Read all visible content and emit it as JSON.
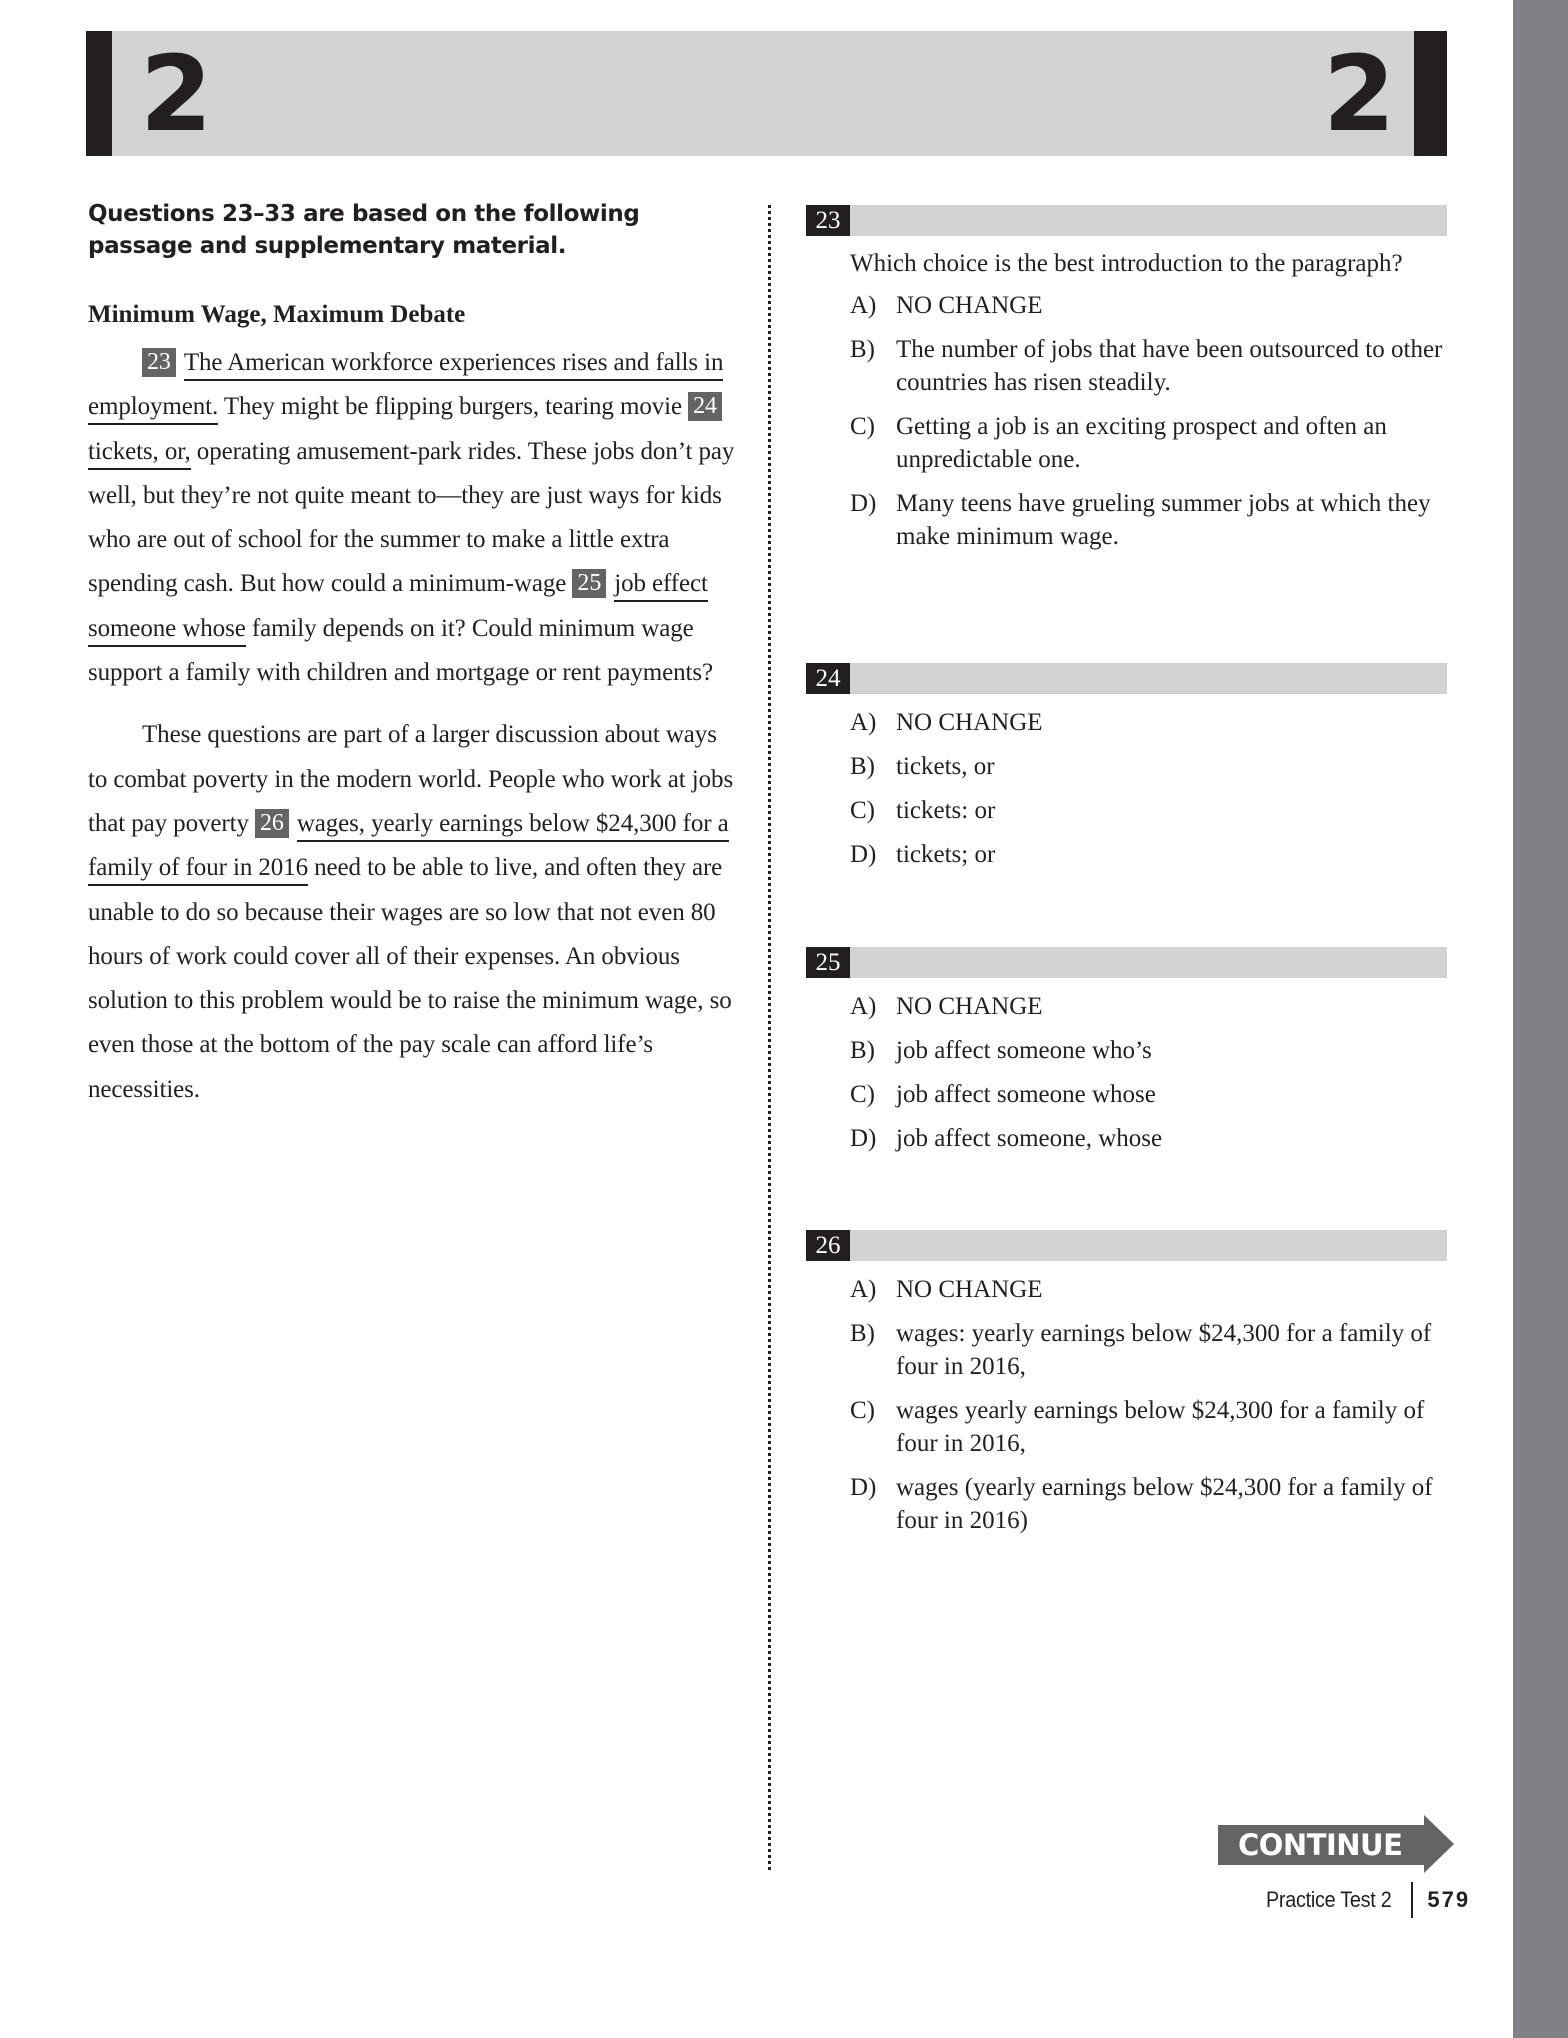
{
  "header": {
    "section_number_left": "2",
    "section_number_right": "2"
  },
  "passage": {
    "intro": "Questions 23–33 are based on the following passage and supplementary material.",
    "title": "Minimum Wage, Maximum Debate",
    "paragraph1": {
      "q23_num": "23",
      "q23_underlined": "The American workforce experiences rises and falls in employment.",
      "seg1": " They might be flipping burgers, tearing movie ",
      "q24_num": "24",
      "q24_underlined": "tickets, or,",
      "seg2": " operating amusement-park rides. These jobs don’t pay well, but they’re not quite meant to—they are just ways for kids who are out of school for the summer to make a little extra spending cash. But how could a minimum-wage ",
      "q25_num": "25",
      "q25_underlined": "job effect someone whose",
      "seg3": " family depends on it? Could minimum wage support a family with children and mortgage or rent payments?"
    },
    "paragraph2": {
      "seg1": "These questions are part of a larger discussion about ways to combat poverty in the modern world. People who work at jobs that pay poverty ",
      "q26_num": "26",
      "q26_underlined": "wages, yearly earnings below $24,300 for a family of four in 2016",
      "seg2": " need to be able to live, and often they are unable to do so because their wages are so low that not even 80 hours of work could cover all of their expenses. An obvious solution to this problem would be to raise the minimum wage, so even those at the bottom of the pay scale can afford life’s necessities."
    }
  },
  "questions": [
    {
      "number": "23",
      "stem": "Which choice is the best introduction to the paragraph?",
      "choices": [
        {
          "letter": "A)",
          "text": "NO CHANGE"
        },
        {
          "letter": "B)",
          "text": "The number of jobs that have been outsourced to other countries has risen steadily."
        },
        {
          "letter": "C)",
          "text": "Getting a job is an exciting prospect and often an unpredictable one."
        },
        {
          "letter": "D)",
          "text": "Many teens have grueling summer jobs at which they make minimum wage."
        }
      ]
    },
    {
      "number": "24",
      "choices": [
        {
          "letter": "A)",
          "text": "NO CHANGE"
        },
        {
          "letter": "B)",
          "text": "tickets, or"
        },
        {
          "letter": "C)",
          "text": "tickets: or"
        },
        {
          "letter": "D)",
          "text": "tickets; or"
        }
      ]
    },
    {
      "number": "25",
      "choices": [
        {
          "letter": "A)",
          "text": "NO CHANGE"
        },
        {
          "letter": "B)",
          "text": "job affect someone who’s"
        },
        {
          "letter": "C)",
          "text": "job affect someone whose"
        },
        {
          "letter": "D)",
          "text": "job affect someone, whose"
        }
      ]
    },
    {
      "number": "26",
      "choices": [
        {
          "letter": "A)",
          "text": "NO CHANGE"
        },
        {
          "letter": "B)",
          "text": "wages: yearly earnings below $24,300 for a family of four in 2016,"
        },
        {
          "letter": "C)",
          "text": "wages yearly earnings below $24,300 for a family of four in 2016,"
        },
        {
          "letter": "D)",
          "text": "wages (yearly earnings below $24,300 for a family of four in 2016)"
        }
      ]
    }
  ],
  "footer": {
    "continue_label": "CONTINUE",
    "test_name": "Practice Test 2",
    "page_number": "579"
  },
  "colors": {
    "header_gray": "#d1d2d4",
    "dark": "#231f20",
    "box_gray": "#636466",
    "side_strip": "#808184"
  }
}
